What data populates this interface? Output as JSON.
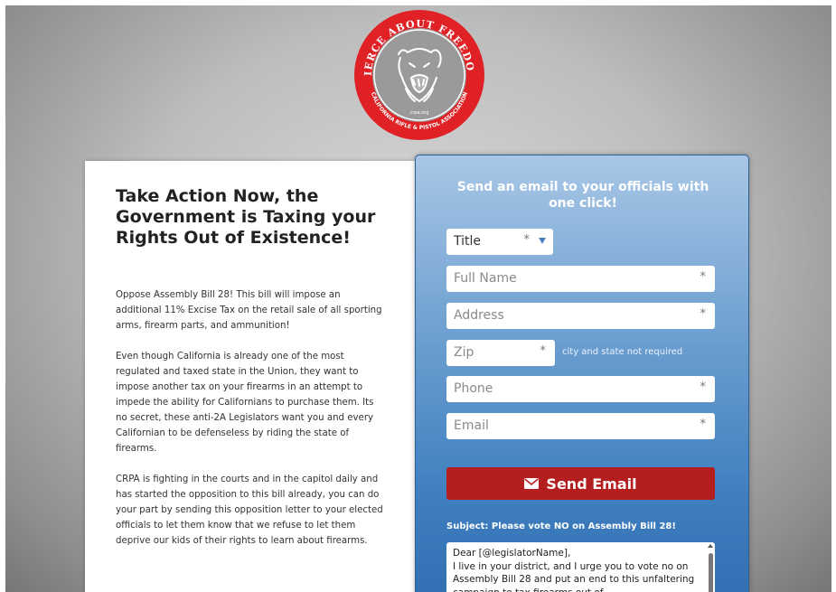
{
  "logo": {
    "top_text": "FIERCE ABOUT FREEDOM",
    "bottom_text": "CALIFORNIA RIFLE & PISTOL ASSOCIATION",
    "site": "crpa.org",
    "ring_color": "#e02125"
  },
  "article": {
    "title": "Take Action Now, the Government is Taxing your Rights Out of Existence!",
    "paragraphs": [
      "Oppose Assembly Bill 28! This bill will impose an additional 11% Excise Tax on the retail sale of all sporting arms, firearm parts, and ammunition!",
      "Even though California is already one of the most regulated and taxed state in the Union, they want to impose another tax on your firearms in an attempt to impede the ability for Californians to purchase them. Its no secret, these anti-2A Legislators want you and every Californian to be defenseless by riding the state of firearms.",
      "CRPA is fighting in the courts and in the capitol daily and has started the opposition to this bill already, you can do your part by sending this opposition letter to your elected officials to let them know that we refuse to let them deprive our kids of their rights to learn about firearms."
    ]
  },
  "form": {
    "heading": "Send an email to your officials with one click!",
    "title_select": {
      "selected": "Title",
      "required": "*"
    },
    "full_name": {
      "placeholder": "Full Name",
      "required": "*"
    },
    "address": {
      "placeholder": "Address",
      "required": "*"
    },
    "zip": {
      "placeholder": "Zip",
      "required": "*",
      "note": "city and state not required"
    },
    "phone": {
      "placeholder": "Phone",
      "required": "*"
    },
    "email": {
      "placeholder": "Email",
      "required": "*"
    },
    "send_button": "Send Email",
    "subject": "Subject: Please vote NO on Assembly Bill 28!",
    "message": "Dear [@legislatorName],\nI live in your district, and I urge you to vote no on Assembly Bill 28 and put an end to this unfaltering campaign to tax firearms out of",
    "button_color": "#b51e1e"
  }
}
